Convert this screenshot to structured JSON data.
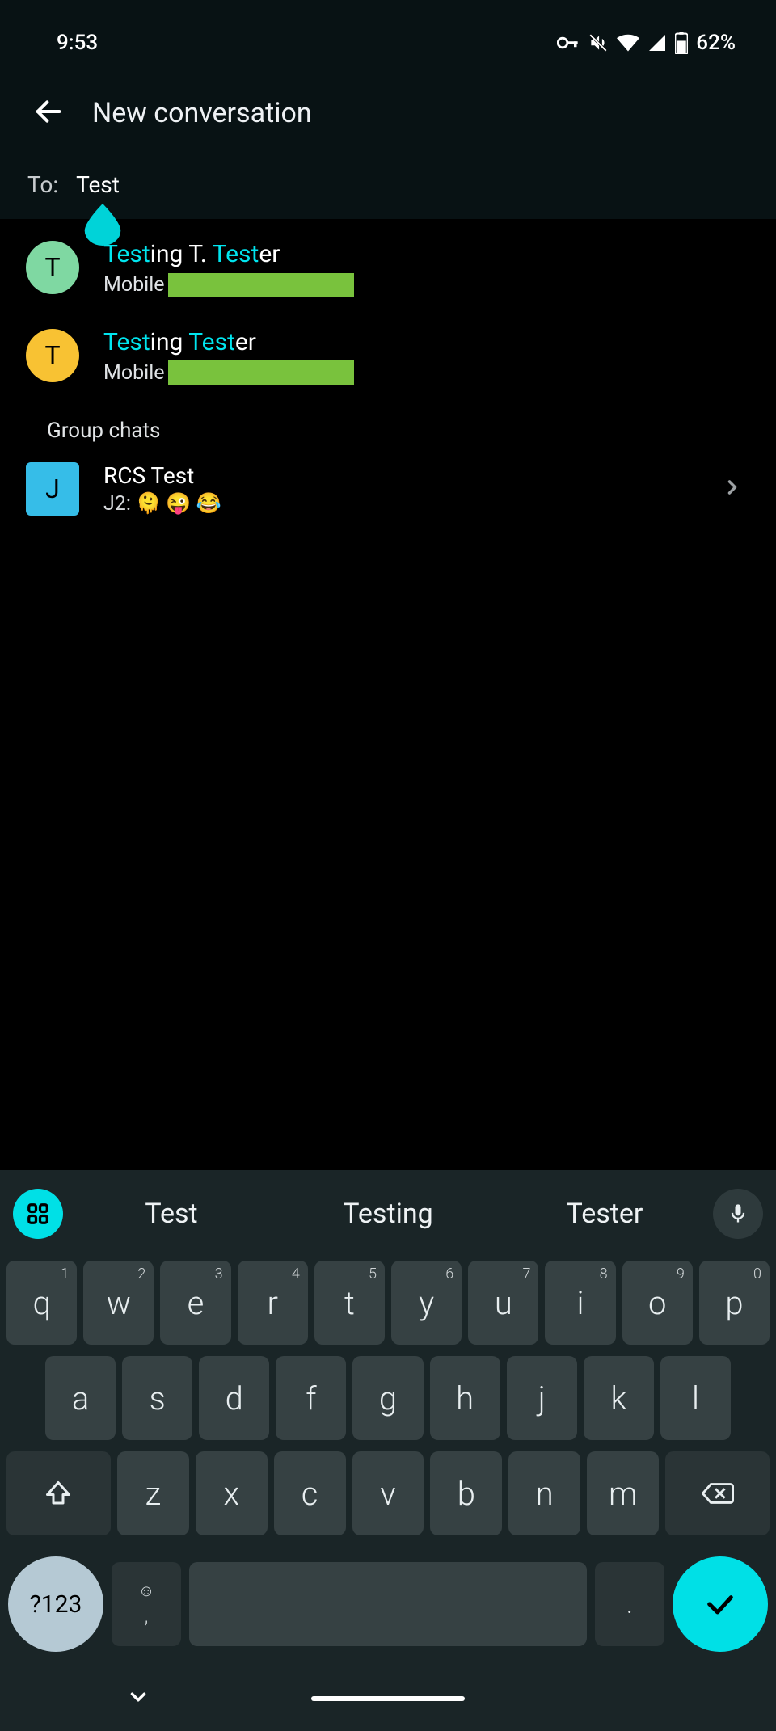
{
  "status": {
    "time": "9:53",
    "battery": "62%"
  },
  "header": {
    "title": "New conversation"
  },
  "to": {
    "label": "To:",
    "value": "Test"
  },
  "contacts": [
    {
      "avatar_letter": "T",
      "avatar_color": "green",
      "name_parts": [
        "Test",
        "ing T. ",
        "Test",
        "er"
      ],
      "sub_label": "Mobile"
    },
    {
      "avatar_letter": "T",
      "avatar_color": "yellow",
      "name_parts": [
        "Test",
        "ing ",
        "Test",
        "er"
      ],
      "sub_label": "Mobile"
    }
  ],
  "group_section_label": "Group chats",
  "groups": [
    {
      "avatar_letter": "J",
      "name": "RCS Test",
      "preview": "J2: 🫠 😜 😂"
    }
  ],
  "keyboard": {
    "suggestions": [
      "Test",
      "Testing",
      "Tester"
    ],
    "row1": [
      {
        "main": "q",
        "alt": "1"
      },
      {
        "main": "w",
        "alt": "2"
      },
      {
        "main": "e",
        "alt": "3"
      },
      {
        "main": "r",
        "alt": "4"
      },
      {
        "main": "t",
        "alt": "5"
      },
      {
        "main": "y",
        "alt": "6"
      },
      {
        "main": "u",
        "alt": "7"
      },
      {
        "main": "i",
        "alt": "8"
      },
      {
        "main": "o",
        "alt": "9"
      },
      {
        "main": "p",
        "alt": "0"
      }
    ],
    "row2": [
      "a",
      "s",
      "d",
      "f",
      "g",
      "h",
      "j",
      "k",
      "l"
    ],
    "row3": [
      "z",
      "x",
      "c",
      "v",
      "b",
      "n",
      "m"
    ],
    "sym_label": "?123",
    "comma": ",",
    "dot": "."
  }
}
